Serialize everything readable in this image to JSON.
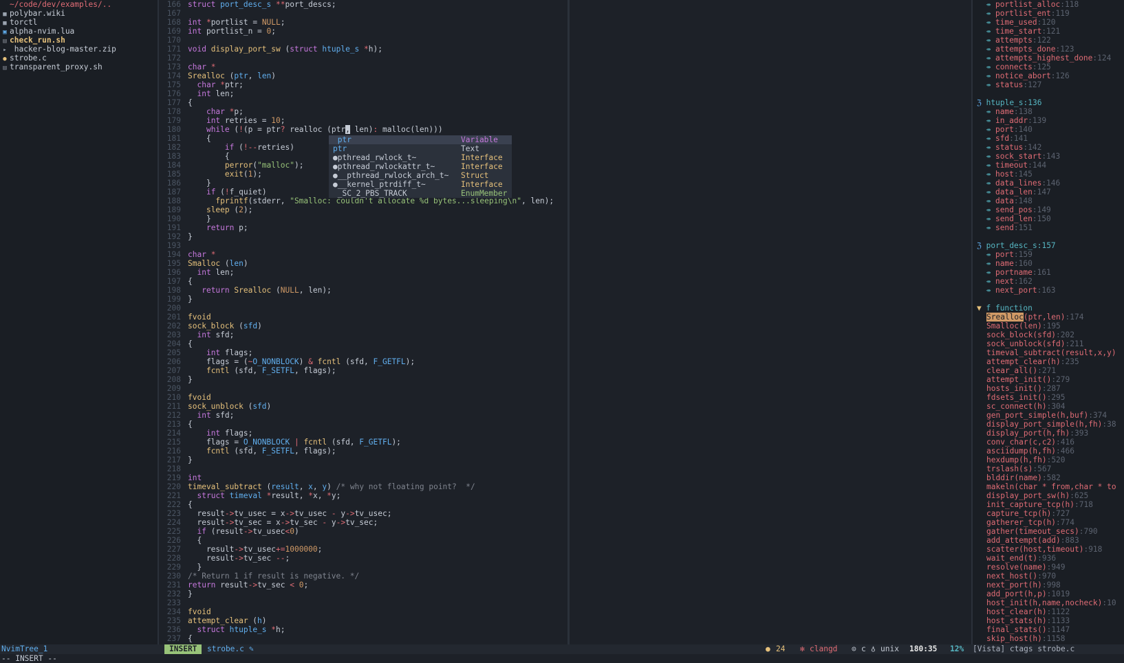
{
  "tree": {
    "header": "~/code/dev/examples/..",
    "items": [
      {
        "icon": "file-icon",
        "label": "polybar.wiki",
        "color": "#c6ccd6"
      },
      {
        "icon": "file-icon",
        "label": "torctl",
        "color": "#c6ccd6"
      },
      {
        "icon": "lua-icon",
        "label": "alpha-nvim.lua",
        "color": "#c6ccd6"
      },
      {
        "icon": "shell-icon",
        "label": "check_run.sh",
        "color": "#e5c07b",
        "bold": true
      },
      {
        "icon": "chevron-right-icon",
        "label": " hacker-blog-master.zip",
        "color": "#c6ccd6"
      },
      {
        "icon": "c-file-icon",
        "label": "strobe.c",
        "color": "#c6ccd6"
      },
      {
        "icon": "shell-icon",
        "label": "transparent_proxy.sh",
        "color": "#c6ccd6"
      }
    ]
  },
  "editor": {
    "lines": [
      {
        "n": "166",
        "h": "<span class='kw'>struct</span> <span class='ty'>port_desc_s</span> <span class='op'>**</span>port_descs;"
      },
      {
        "n": "167",
        "h": ""
      },
      {
        "n": "168",
        "h": "<span class='kw'>int</span> <span class='op'>*</span>portlist = <span class='num'>NULL</span>;"
      },
      {
        "n": "169",
        "h": "<span class='kw'>int</span> portlist_n = <span class='num'>0</span>;"
      },
      {
        "n": "170",
        "h": ""
      },
      {
        "n": "171",
        "h": "<span class='kw'>void</span> <span class='fn'>display_port_sw</span> (<span class='kw'>struct</span> <span class='ty'>htuple_s</span> <span class='op'>*</span>h);"
      },
      {
        "n": "172",
        "h": ""
      },
      {
        "n": "173",
        "h": "<span class='kw'>char</span> <span class='op'>*</span>"
      },
      {
        "n": "174",
        "h": "<span class='fn'>Srealloc</span> (<span class='ty'>ptr</span>, <span class='ty'>len</span>)"
      },
      {
        "n": "175",
        "h": "  <span class='kw'>char</span> <span class='op'>*</span>ptr;"
      },
      {
        "n": "176",
        "h": "  <span class='kw'>int</span> len;"
      },
      {
        "n": "177",
        "h": "{"
      },
      {
        "n": "178",
        "h": "    <span class='kw'>char</span> <span class='op'>*</span>p;"
      },
      {
        "n": "179",
        "h": "    <span class='kw'>int</span> retries = <span class='num'>10</span>;"
      },
      {
        "n": "180",
        "h": "    <span class='kw'>while</span> (<span class='op'>!</span>(p = ptr<span class='op'>?</span> realloc (ptr<span style='background:#c6ccd6;color:#1d2128'>,</span> len)<span class='op'>:</span> malloc(len)))"
      },
      {
        "n": "181",
        "h": "    {"
      },
      {
        "n": "182",
        "h": "        <span class='kw'>if</span> (<span class='op'>!--</span>retries)"
      },
      {
        "n": "183",
        "h": "        {"
      },
      {
        "n": "184",
        "h": "        <span class='fn'>perror</span>(<span class='str'>\"malloc\"</span>);"
      },
      {
        "n": "185",
        "h": "        <span class='fn'>exit</span>(<span class='num'>1</span>);"
      },
      {
        "n": "186",
        "h": "    }"
      },
      {
        "n": "187",
        "h": "    <span class='kw'>if</span> (<span class='op'>!</span>f_quiet)"
      },
      {
        "n": "188",
        "h": "      <span class='fn'>fprintf</span>(stderr, <span class='str'>\"Smalloc: couldn't allocate %d bytes...sleeping\\n\"</span>, len);"
      },
      {
        "n": "189",
        "h": "    <span class='fn'>sleep</span> (<span class='num'>2</span>);"
      },
      {
        "n": "190",
        "h": "    }"
      },
      {
        "n": "191",
        "h": "    <span class='kw'>return</span> p;"
      },
      {
        "n": "192",
        "h": "}"
      },
      {
        "n": "193",
        "h": ""
      },
      {
        "n": "194",
        "h": "<span class='kw'>char</span> <span class='op'>*</span>"
      },
      {
        "n": "195",
        "h": "<span class='fn'>Smalloc</span> (<span class='ty'>len</span>)"
      },
      {
        "n": "196",
        "h": "  <span class='kw'>int</span> len;"
      },
      {
        "n": "197",
        "h": "{"
      },
      {
        "n": "198",
        "h": "   <span class='kw'>return</span> <span class='fn'>Srealloc</span> (<span class='num'>NULL</span>, len);"
      },
      {
        "n": "199",
        "h": "}"
      },
      {
        "n": "200",
        "h": ""
      },
      {
        "n": "201",
        "h": "<span class='fn'>fvoid</span>"
      },
      {
        "n": "202",
        "h": "<span class='fn'>sock_block</span> (<span class='ty'>sfd</span>)"
      },
      {
        "n": "203",
        "h": "  <span class='kw'>int</span> sfd;"
      },
      {
        "n": "204",
        "h": "{"
      },
      {
        "n": "205",
        "h": "    <span class='kw'>int</span> flags;"
      },
      {
        "n": "206",
        "h": "    flags = (<span class='op'>~</span><span class='ty'>O_NONBLOCK</span>) <span class='op'>&amp;</span> <span class='fn'>fcntl</span> (sfd, <span class='ty'>F_GETFL</span>);"
      },
      {
        "n": "207",
        "h": "    <span class='fn'>fcntl</span> (sfd, <span class='ty'>F_SETFL</span>, flags);"
      },
      {
        "n": "208",
        "h": "}"
      },
      {
        "n": "209",
        "h": ""
      },
      {
        "n": "210",
        "h": "<span class='fn'>fvoid</span>"
      },
      {
        "n": "211",
        "h": "<span class='fn'>sock_unblock</span> (<span class='ty'>sfd</span>)"
      },
      {
        "n": "212",
        "h": "  <span class='kw'>int</span> sfd;"
      },
      {
        "n": "213",
        "h": "{"
      },
      {
        "n": "214",
        "h": "    <span class='kw'>int</span> flags;"
      },
      {
        "n": "215",
        "h": "    flags = <span class='ty'>O_NONBLOCK</span> <span class='op'>|</span> <span class='fn'>fcntl</span> (sfd, <span class='ty'>F_GETFL</span>);"
      },
      {
        "n": "216",
        "h": "    <span class='fn'>fcntl</span> (sfd, <span class='ty'>F_SETFL</span>, flags);"
      },
      {
        "n": "217",
        "h": "}"
      },
      {
        "n": "218",
        "h": ""
      },
      {
        "n": "219",
        "h": "<span class='kw'>int</span>"
      },
      {
        "n": "220",
        "h": "<span class='fn'>timeval_subtract</span> (<span class='ty'>result</span>, <span class='ty'>x</span>, <span class='ty'>y</span>) <span class='cm'>/* why not floating point?  */</span>"
      },
      {
        "n": "221",
        "h": "  <span class='kw'>struct</span> <span class='ty'>timeval</span> <span class='op'>*</span>result, <span class='op'>*</span>x, <span class='op'>*</span>y;"
      },
      {
        "n": "222",
        "h": "{"
      },
      {
        "n": "223",
        "h": "  result<span class='op'>-&gt;</span>tv_usec = x<span class='op'>-&gt;</span>tv_usec <span class='op'>-</span> y<span class='op'>-&gt;</span>tv_usec;"
      },
      {
        "n": "224",
        "h": "  result<span class='op'>-&gt;</span>tv_sec = x<span class='op'>-&gt;</span>tv_sec <span class='op'>-</span> y<span class='op'>-&gt;</span>tv_sec;"
      },
      {
        "n": "225",
        "h": "  <span class='kw'>if</span> (result<span class='op'>-&gt;</span>tv_usec<span class='op'>&lt;</span><span class='num'>0</span>)"
      },
      {
        "n": "226",
        "h": "  {"
      },
      {
        "n": "227",
        "h": "    result<span class='op'>-&gt;</span>tv_usec<span class='op'>+=</span><span class='num'>1000000</span>;"
      },
      {
        "n": "228",
        "h": "    result<span class='op'>-&gt;</span>tv_sec <span class='op'>--</span>;"
      },
      {
        "n": "229",
        "h": "  }"
      },
      {
        "n": "230",
        "h": "<span class='cm'>/* Return 1 if result is negative. */</span>"
      },
      {
        "n": "231",
        "h": "<span class='kw'>return</span> result<span class='op'>-&gt;</span>tv_sec <span class='op'>&lt;</span> <span class='num'>0</span>;"
      },
      {
        "n": "232",
        "h": "}"
      },
      {
        "n": "233",
        "h": ""
      },
      {
        "n": "234",
        "h": "<span class='fn'>fvoid</span>"
      },
      {
        "n": "235",
        "h": "<span class='fn'>attempt_clear</span> (<span class='ty'>h</span>)"
      },
      {
        "n": "236",
        "h": "  <span class='kw'>struct</span> <span class='ty'>htuple_s</span> <span class='op'>*</span>h;"
      },
      {
        "n": "237",
        "h": "{"
      }
    ]
  },
  "completion": {
    "items": [
      {
        "label": " ptr",
        "kind": "Variable",
        "kind_color": "#c678dd",
        "label_color": "#61afef",
        "selected": true
      },
      {
        "label": "ptr",
        "kind": "Text",
        "kind_color": "#c6ccd6",
        "label_color": "#61afef"
      },
      {
        "label": "●pthread_rwlock_t~",
        "kind": "Interface",
        "kind_color": "#e5c07b",
        "label_color": "#c6ccd6"
      },
      {
        "label": "●pthread_rwlockattr_t~",
        "kind": "Interface",
        "kind_color": "#e5c07b",
        "label_color": "#c6ccd6"
      },
      {
        "label": "●__pthread_rwlock_arch_t~",
        "kind": "Struct",
        "kind_color": "#e5c07b",
        "label_color": "#c6ccd6"
      },
      {
        "label": "●__kernel_ptrdiff_t~",
        "kind": "Interface",
        "kind_color": "#e5c07b",
        "label_color": "#c6ccd6"
      },
      {
        "label": " _SC_2_PBS_TRACK",
        "kind": "EnumMember",
        "kind_color": "#98c379",
        "label_color": "#c6ccd6"
      }
    ]
  },
  "vista": {
    "rows": [
      {
        "t": "m",
        "name": "portlist_alloc",
        "ln": "118"
      },
      {
        "t": "m",
        "name": "portlist_ent",
        "ln": "119"
      },
      {
        "t": "m",
        "name": "time_used",
        "ln": "120"
      },
      {
        "t": "m",
        "name": "time_start",
        "ln": "121"
      },
      {
        "t": "m",
        "name": "attempts",
        "ln": "122"
      },
      {
        "t": "m",
        "name": "attempts_done",
        "ln": "123"
      },
      {
        "t": "m",
        "name": "attempts_highest_done",
        "ln": "124"
      },
      {
        "t": "m",
        "name": "connects",
        "ln": "125"
      },
      {
        "t": "m",
        "name": "notice_abort",
        "ln": "126"
      },
      {
        "t": "m",
        "name": "status",
        "ln": "127"
      },
      {
        "t": "b"
      },
      {
        "t": "g",
        "name": "htuple_s",
        "ln": "136"
      },
      {
        "t": "m",
        "name": "name",
        "ln": "138"
      },
      {
        "t": "m",
        "name": "in_addr",
        "ln": "139"
      },
      {
        "t": "m",
        "name": "port",
        "ln": "140"
      },
      {
        "t": "m",
        "name": "sfd",
        "ln": "141"
      },
      {
        "t": "m",
        "name": "status",
        "ln": "142"
      },
      {
        "t": "m",
        "name": "sock_start",
        "ln": "143"
      },
      {
        "t": "m",
        "name": "timeout",
        "ln": "144"
      },
      {
        "t": "m",
        "name": "host",
        "ln": "145"
      },
      {
        "t": "m",
        "name": "data_lines",
        "ln": "146"
      },
      {
        "t": "m",
        "name": "data_len",
        "ln": "147"
      },
      {
        "t": "m",
        "name": "data",
        "ln": "148"
      },
      {
        "t": "m",
        "name": "send_pos",
        "ln": "149"
      },
      {
        "t": "m",
        "name": "send_len",
        "ln": "150"
      },
      {
        "t": "m",
        "name": "send",
        "ln": "151"
      },
      {
        "t": "b"
      },
      {
        "t": "g",
        "name": "port_desc_s",
        "ln": "157"
      },
      {
        "t": "m",
        "name": "port",
        "ln": "159"
      },
      {
        "t": "m",
        "name": "name",
        "ln": "160"
      },
      {
        "t": "m",
        "name": "portname",
        "ln": "161"
      },
      {
        "t": "m",
        "name": "next",
        "ln": "162"
      },
      {
        "t": "m",
        "name": "next_port",
        "ln": "163"
      },
      {
        "t": "b"
      },
      {
        "t": "h",
        "name": "f function"
      },
      {
        "t": "f",
        "name": "Srealloc",
        "args": "(ptr,len)",
        "ln": "174",
        "hl": true
      },
      {
        "t": "f",
        "name": "Smalloc",
        "args": "(len)",
        "ln": "195"
      },
      {
        "t": "f",
        "name": "sock_block",
        "args": "(sfd)",
        "ln": "202"
      },
      {
        "t": "f",
        "name": "sock_unblock",
        "args": "(sfd)",
        "ln": "211"
      },
      {
        "t": "f",
        "name": "timeval_subtract",
        "args": "(result,x,y)",
        "ln": ""
      },
      {
        "t": "f",
        "name": "attempt_clear",
        "args": "(h)",
        "ln": "235"
      },
      {
        "t": "f",
        "name": "clear_all",
        "args": "()",
        "ln": "271"
      },
      {
        "t": "f",
        "name": "attempt_init",
        "args": "()",
        "ln": "279"
      },
      {
        "t": "f",
        "name": "hosts_init",
        "args": "()",
        "ln": "287"
      },
      {
        "t": "f",
        "name": "fdsets_init",
        "args": "()",
        "ln": "295"
      },
      {
        "t": "f",
        "name": "sc_connect",
        "args": "(h)",
        "ln": "304"
      },
      {
        "t": "f",
        "name": "gen_port_simple",
        "args": "(h,buf)",
        "ln": "374"
      },
      {
        "t": "f",
        "name": "display_port_simple",
        "args": "(h,fh)",
        "ln": "38"
      },
      {
        "t": "f",
        "name": "display_port",
        "args": "(h,fh)",
        "ln": "393"
      },
      {
        "t": "f",
        "name": "conv_char",
        "args": "(c,c2)",
        "ln": "416"
      },
      {
        "t": "f",
        "name": "asciidump",
        "args": "(h,fh)",
        "ln": "466"
      },
      {
        "t": "f",
        "name": "hexdump",
        "args": "(h,fh)",
        "ln": "520"
      },
      {
        "t": "f",
        "name": "trslash",
        "args": "(s)",
        "ln": "567"
      },
      {
        "t": "f",
        "name": "blddir",
        "args": "(name)",
        "ln": "582"
      },
      {
        "t": "f",
        "name": "makeln",
        "args": "(char * from,char * to",
        "ln": ""
      },
      {
        "t": "f",
        "name": "display_port_sw",
        "args": "(h)",
        "ln": "625"
      },
      {
        "t": "f",
        "name": "init_capture_tcp",
        "args": "(h)",
        "ln": "718"
      },
      {
        "t": "f",
        "name": "capture_tcp",
        "args": "(h)",
        "ln": "727"
      },
      {
        "t": "f",
        "name": "gatherer_tcp",
        "args": "(h)",
        "ln": "774"
      },
      {
        "t": "f",
        "name": "gather",
        "args": "(timeout_secs)",
        "ln": "790"
      },
      {
        "t": "f",
        "name": "add_attempt",
        "args": "(add)",
        "ln": "883"
      },
      {
        "t": "f",
        "name": "scatter",
        "args": "(host,timeout)",
        "ln": "918"
      },
      {
        "t": "f",
        "name": "wait_end",
        "args": "(t)",
        "ln": "936"
      },
      {
        "t": "f",
        "name": "resolve",
        "args": "(name)",
        "ln": "949"
      },
      {
        "t": "f",
        "name": "next_host",
        "args": "()",
        "ln": "970"
      },
      {
        "t": "f",
        "name": "next_port",
        "args": "(h)",
        "ln": "998"
      },
      {
        "t": "f",
        "name": "add_port",
        "args": "(h,p)",
        "ln": "1019"
      },
      {
        "t": "f",
        "name": "host_init",
        "args": "(h,name,nocheck)",
        "ln": "10"
      },
      {
        "t": "f",
        "name": "host_clear",
        "args": "(h)",
        "ln": "1122"
      },
      {
        "t": "f",
        "name": "host_stats",
        "args": "(h)",
        "ln": "1133"
      },
      {
        "t": "f",
        "name": "final_stats",
        "args": "()",
        "ln": "1147"
      },
      {
        "t": "f",
        "name": "skip_host",
        "args": "(h)",
        "ln": "1158"
      }
    ]
  },
  "status": {
    "tree_name": "NvimTree_1",
    "mode": "INSERT",
    "filename": "strobe.c",
    "warnings": "24",
    "lsp": "clangd",
    "filetype": "c",
    "fileformat": "unix",
    "position": "180:35",
    "percent": "12%",
    "vista_label": "[Vista] ctags strobe.c"
  },
  "cmdline": "-- INSERT --",
  "colors": {
    "background": "#1d2128",
    "mode_bg": "#98c379",
    "accent": "#61afef"
  }
}
